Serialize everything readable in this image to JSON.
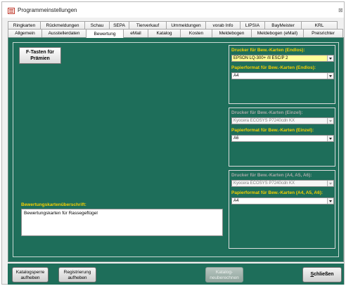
{
  "window": {
    "title": "Programmeinstellungen",
    "close_glyph": "⊠"
  },
  "tabs_row1": [
    "Ringkarten",
    "Rückmeldungen",
    "Schau",
    "SEPA",
    "Tierverkauf",
    "Ummeldungen",
    "vorab Info",
    "LIPSIA",
    "BayMeister",
    "KRL"
  ],
  "tabs_row2": [
    "Allgemein",
    "Ausstellerdaten",
    "Bewertung",
    "eMail",
    "Katalog",
    "Kosten",
    "Meldebogen",
    "Meldebogen (eMail)",
    "Preisrichter"
  ],
  "active_tab": "Bewertung",
  "ftasten_button": "F-Tasten für Prämien",
  "group_endlos": {
    "printer_label": "Drucker für Bew.-Karten (Endlos):",
    "printer_value": "EPSON LQ-300+ /II ESC/P 2",
    "format_label": "Papierformat für Bew.-Karten (Endlos):",
    "format_value": "A4"
  },
  "group_einzel": {
    "printer_label": "Drucker für Bew.-Karten (Einzel):",
    "printer_value": "Kyocera ECOSYS P7240cdn KX",
    "format_label": "Papierformat für Bew.-Karten (Einzel):",
    "format_value": "A6"
  },
  "group_a4a5a6": {
    "printer_label": "Drucker für Bew.-Karten (A4, A5, A6):",
    "printer_value": "Kyocera ECOSYS P7240cdn KX",
    "format_label": "Papierformat für Bew.-Karten (A4, A5, A6):",
    "format_value": "A4"
  },
  "bewertung": {
    "label": "Bewertungskartenüberschrift:",
    "value": "Bewertungskarten für Rassegeflügel"
  },
  "buttons": {
    "katalogsperre": "Katalogsperre aufheben",
    "registrierung": "Registrierung aufheben",
    "katalog_neu": "Katalog-neuberechnen",
    "schliessen_rest": "chließen",
    "schliessen_accel": "S"
  },
  "colors": {
    "panel": "#1e6e5a",
    "label_yellow": "#f7d000",
    "highlight_combo": "#ffff99"
  }
}
